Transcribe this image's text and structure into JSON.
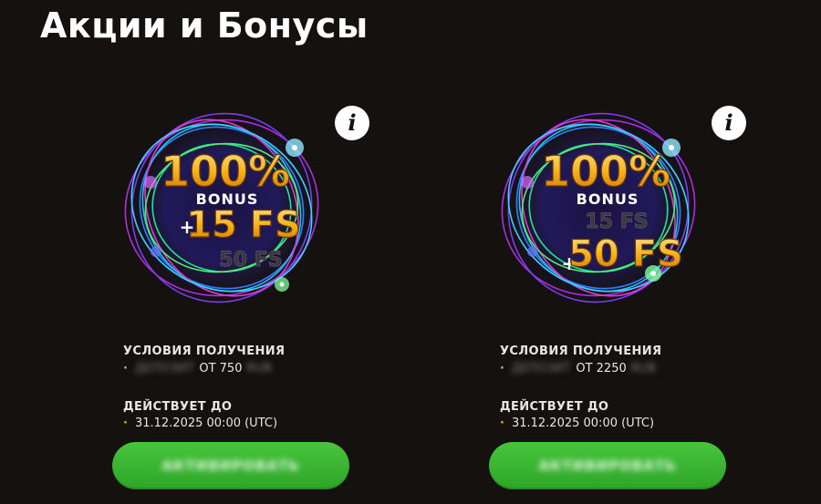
{
  "page": {
    "title": "Акции и Бонусы"
  },
  "cards": [
    {
      "badge": {
        "percent": "100%",
        "bonus_word": "BONUS",
        "primary_fs": "15 FS",
        "secondary_fs": "50 FS",
        "plus_sign": "+"
      },
      "info_label": "i",
      "conditions_label": "УСЛОВИЯ ПОЛУЧЕНИЯ",
      "conditions_blurred_prefix": "ДЕПОЗИТ",
      "conditions_value": "ОТ 750",
      "conditions_blurred_suffix": "RUB",
      "valid_label": "ДЕЙСТВУЕТ ДО",
      "valid_value": "31.12.2025 00:00 (UTC)",
      "bullet": "·",
      "activate_label": "АКТИВИРОВАТЬ"
    },
    {
      "badge": {
        "percent": "100%",
        "bonus_word": "BONUS",
        "primary_fs": "50 FS",
        "secondary_fs": "15 FS",
        "plus_sign": "+"
      },
      "info_label": "i",
      "conditions_label": "УСЛОВИЯ ПОЛУЧЕНИЯ",
      "conditions_blurred_prefix": "ДЕПОЗИТ",
      "conditions_value": "ОТ 2250",
      "conditions_blurred_suffix": "RUB",
      "valid_label": "ДЕЙСТВУЕТ ДО",
      "valid_value": "31.12.2025 00:00 (UTC)",
      "bullet": "·",
      "activate_label": "АКТИВИРОВАТЬ"
    }
  ],
  "colors": {
    "background": "#15110f",
    "accent_orange": "#f0a31c",
    "button_green": "#3cb833",
    "text": "#e9e6e3"
  }
}
